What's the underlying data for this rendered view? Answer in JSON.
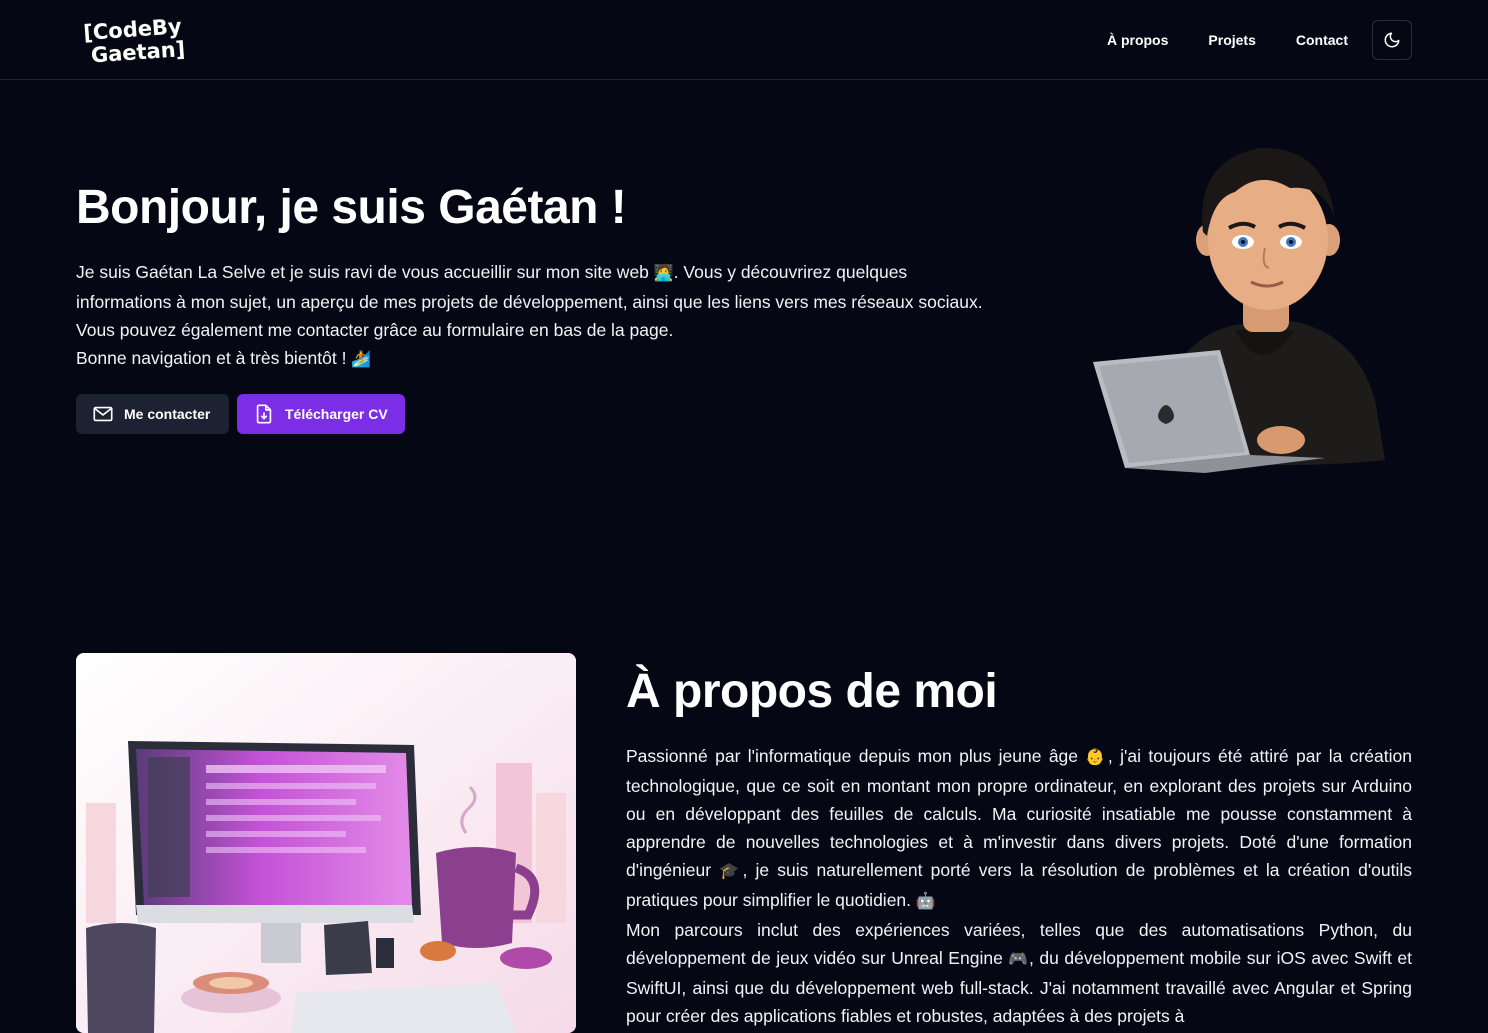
{
  "header": {
    "logo_line1": "[CodeBy",
    "logo_line2": "Gaetan]",
    "nav": [
      {
        "label": "À propos"
      },
      {
        "label": "Projets"
      },
      {
        "label": "Contact"
      }
    ],
    "theme_icon": "moon-icon"
  },
  "hero": {
    "title": "Bonjour, je suis Gaétan !",
    "paragraph1_part1": "Je suis Gaétan La Selve et je suis ravi de vous accueillir sur mon site web ",
    "paragraph1_emoji": "🧑‍💻",
    "paragraph1_part2": ". Vous y découvrirez quelques informations à mon sujet, un aperçu de mes projets de développement, ainsi que les liens vers mes réseaux sociaux. Vous pouvez également me contacter grâce au formulaire en bas de la page.",
    "paragraph2": "Bonne navigation et à très bientôt ! ",
    "paragraph2_emoji": "🏄",
    "contact_button": "Me contacter",
    "cv_button": "Télécharger CV"
  },
  "about": {
    "title": "À propos de moi",
    "p1_a": "Passionné par l'informatique depuis mon plus jeune âge ",
    "p1_emoji1": "👶",
    "p1_b": ", j'ai toujours été attiré par la création technologique, que ce soit en montant mon propre ordinateur, en explorant des projets sur Arduino ou en développant des feuilles de calculs. Ma curiosité insatiable me pousse constamment à apprendre de nouvelles technologies et à m'investir dans divers projets. Doté d'une formation d'ingénieur ",
    "p1_emoji2": "🎓",
    "p1_c": ", je suis naturellement porté vers la résolution de problèmes et la création d'outils pratiques pour simplifier le quotidien. ",
    "p1_emoji3": "🤖",
    "p2_a": "Mon parcours inclut des expériences variées, telles que des automatisations Python, du développement de jeux vidéo sur Unreal Engine ",
    "p2_emoji": "🎮",
    "p2_b": ", du développement mobile sur iOS avec Swift et SwiftUI, ainsi que du développement web full-stack. J'ai notamment travaillé avec Angular et Spring pour créer des applications fiables et robustes, adaptées à des projets à"
  },
  "colors": {
    "background": "#050814",
    "primary_button": "#7c2ee6",
    "secondary_button": "#1c2231"
  }
}
